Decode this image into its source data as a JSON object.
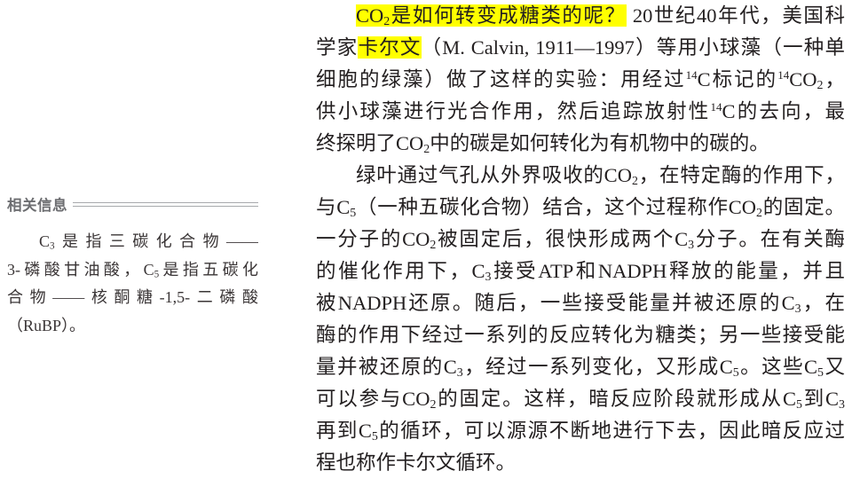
{
  "colors": {
    "text": "#231f20",
    "highlight": "#ffff00",
    "sidebar_heading": "#6d6e71",
    "sidebar_rule": "#a7a9ac"
  },
  "sidebar": {
    "heading": "相关信息",
    "lines": [
      [
        {
          "text": "C"
        },
        {
          "sub": "3"
        },
        {
          "text": "是指三碳化合物——"
        }
      ],
      [
        {
          "text": "3-磷酸甘油酸，C"
        },
        {
          "sub": "5"
        },
        {
          "text": "是指五碳化"
        }
      ],
      [
        {
          "text": "合物——核酮糖-1,5-二磷酸"
        }
      ],
      [
        {
          "text": "（RuBP）。"
        }
      ]
    ]
  },
  "main": {
    "paragraphs": [
      {
        "lines": [
          [
            {
              "text": "CO",
              "highlight": true
            },
            {
              "sub": "2",
              "highlight": true
            },
            {
              "text": "是如何转变成糖类的呢？",
              "highlight": true
            },
            {
              "text": " 20世纪40年代，美国科"
            }
          ],
          [
            {
              "text": "学家"
            },
            {
              "text": "卡尔文",
              "highlight": true
            },
            {
              "text": "（M. Calvin, 1911—1997）等用小球藻（一种单"
            }
          ],
          [
            {
              "text": "细胞的绿藻）做了这样的实验：用经过"
            },
            {
              "sup": "14"
            },
            {
              "text": "C标记的"
            },
            {
              "sup": "14"
            },
            {
              "text": "CO"
            },
            {
              "sub": "2"
            },
            {
              "text": "，"
            }
          ],
          [
            {
              "text": "供小球藻进行光合作用，然后追踪放射性"
            },
            {
              "sup": "14"
            },
            {
              "text": "C的去向，最"
            }
          ],
          [
            {
              "text": "终探明了CO"
            },
            {
              "sub": "2"
            },
            {
              "text": "中的碳是如何转化为有机物中的碳的。"
            }
          ]
        ]
      },
      {
        "lines": [
          [
            {
              "text": "绿叶通过气孔从外界吸收的CO"
            },
            {
              "sub": "2"
            },
            {
              "text": "，在特定酶的作用下，"
            }
          ],
          [
            {
              "text": "与C"
            },
            {
              "sub": "5"
            },
            {
              "text": "（一种五碳化合物）结合，这个过程称作CO"
            },
            {
              "sub": "2"
            },
            {
              "text": "的固定。"
            }
          ],
          [
            {
              "text": "一分子的CO"
            },
            {
              "sub": "2"
            },
            {
              "text": "被固定后，很快形成两个C"
            },
            {
              "sub": "3"
            },
            {
              "text": "分子。在有关酶"
            }
          ],
          [
            {
              "text": "的催化作用下，C"
            },
            {
              "sub": "3"
            },
            {
              "text": "接受ATP和NADPH释放的能量，并且"
            }
          ],
          [
            {
              "text": "被NADPH还原。随后，一些接受能量并被还原的C"
            },
            {
              "sub": "3"
            },
            {
              "text": "，在"
            }
          ],
          [
            {
              "text": "酶的作用下经过一系列的反应转化为糖类；另一些接受能"
            }
          ],
          [
            {
              "text": "量并被还原的C"
            },
            {
              "sub": "3"
            },
            {
              "text": "，经过一系列变化，又形成C"
            },
            {
              "sub": "5"
            },
            {
              "text": "。这些C"
            },
            {
              "sub": "5"
            },
            {
              "text": "又"
            }
          ],
          [
            {
              "text": "可以参与CO"
            },
            {
              "sub": "2"
            },
            {
              "text": "的固定。这样，暗反应阶段就形成从C"
            },
            {
              "sub": "5"
            },
            {
              "text": "到C"
            },
            {
              "sub": "3"
            }
          ],
          [
            {
              "text": "再到C"
            },
            {
              "sub": "5"
            },
            {
              "text": "的循环，可以源源不断地进行下去，因此暗反应过"
            }
          ],
          [
            {
              "text": "程也称作卡尔文循环。"
            }
          ]
        ]
      }
    ]
  }
}
